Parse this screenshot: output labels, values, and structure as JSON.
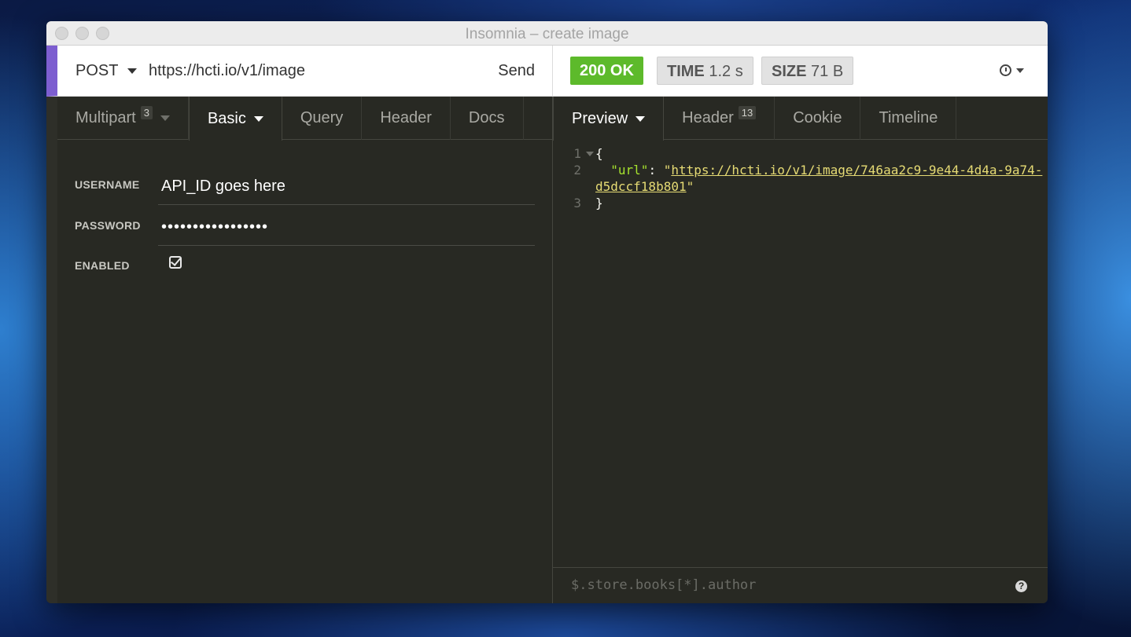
{
  "window": {
    "title": "Insomnia – create image"
  },
  "request": {
    "method": "POST",
    "url": "https://hcti.io/v1/image",
    "send_label": "Send",
    "tabs": [
      {
        "label": "Multipart",
        "badge": "3"
      },
      {
        "label": "Basic"
      },
      {
        "label": "Query"
      },
      {
        "label": "Header"
      },
      {
        "label": "Docs"
      }
    ],
    "auth": {
      "username_label": "USERNAME",
      "username_value": "API_ID goes here",
      "password_label": "PASSWORD",
      "password_value": "•••••••••••••••••",
      "enabled_label": "ENABLED",
      "enabled": true
    }
  },
  "response": {
    "status": "200 OK",
    "time_label": "TIME",
    "time_value": "1.2 s",
    "size_label": "SIZE",
    "size_value": "71 B",
    "tabs": [
      {
        "label": "Preview"
      },
      {
        "label": "Header",
        "badge": "13"
      },
      {
        "label": "Cookie"
      },
      {
        "label": "Timeline"
      }
    ],
    "body": {
      "line_numbers": [
        "1",
        "2",
        "3"
      ],
      "open_brace": "{",
      "key": "\"url\"",
      "colon": ": ",
      "quote_open": "\"",
      "url_part1": "https://hcti.io/v1/image/746aa2c9-9e44-4d4a-9a74-",
      "url_part2": "d5dccf18b801",
      "quote_close": "\"",
      "close_brace": "}"
    },
    "filter_placeholder": "$.store.books[*].author"
  },
  "colors": {
    "accent": "#7d5ed0",
    "status_ok": "#5dba2b",
    "background": "#282923"
  },
  "icons": [
    "history-clock-icon",
    "help-icon",
    "checkbox-checked-icon",
    "chevron-down-icon"
  ]
}
